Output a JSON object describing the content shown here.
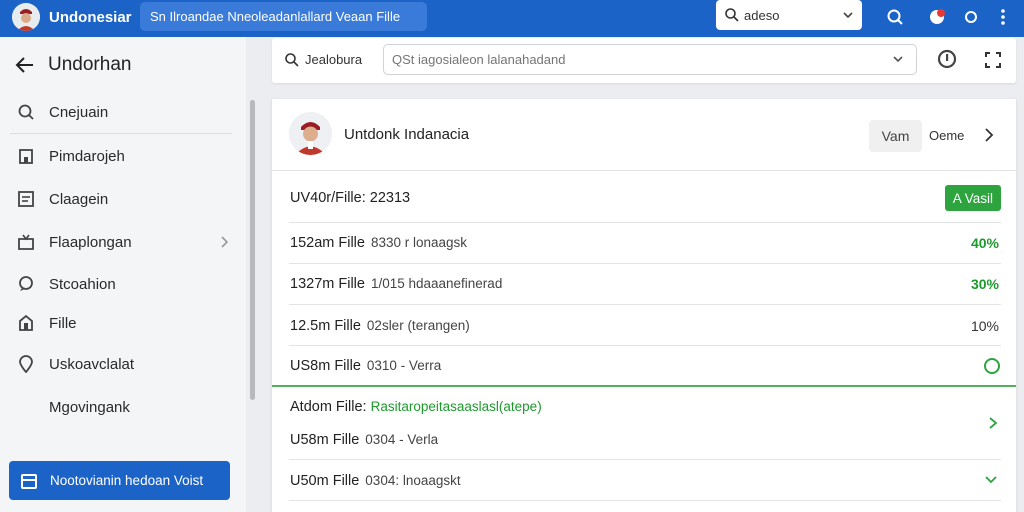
{
  "topbar": {
    "app_title": "Undonesiar",
    "breadcrumb": "Sn Ilroandae Nneoleadanlallard Veaan Fille",
    "search_value": "adeso",
    "icons": [
      "notification-icon",
      "alert-icon",
      "help-icon",
      "more-vert-icon"
    ],
    "colors": {
      "brand": "#1b63c6",
      "accent_green": "#2ea43f"
    }
  },
  "sidebar": {
    "title": "Undorhan",
    "items": [
      {
        "label": "Cnejuain",
        "icon": "search-people-icon"
      },
      {
        "label": "Pimdarojeh",
        "icon": "building-icon"
      },
      {
        "label": "Claagein",
        "icon": "document-icon"
      },
      {
        "label": "Flaaplongan",
        "icon": "inbox-icon",
        "has_chevron": true
      },
      {
        "label": "Stcoahion",
        "icon": "chat-icon"
      },
      {
        "label": "Fille",
        "icon": "store-icon"
      },
      {
        "label": "Uskoavclalat",
        "icon": "location-icon"
      },
      {
        "label": "Mgovingank",
        "icon": ""
      }
    ],
    "action_button": "Nootovianin hedoan Voist"
  },
  "searchbar": {
    "label": "Jealobura",
    "placeholder": "QSt iagosialeon lalanahadand"
  },
  "card": {
    "user_name": "Untdonk Indanacia",
    "button_label": "Vam",
    "link_label": "Oeme",
    "header_row": {
      "name": "UV40r/Fille: 22313",
      "badge": "A Vasil"
    },
    "rows": [
      {
        "name": "152am Fille",
        "desc": "8330 r lonaagsk",
        "pct": "40%",
        "pct_color": "#1e9a2d"
      },
      {
        "name": "1327m Fille",
        "desc": "1/015 hdaaanefinerad",
        "pct": "30%",
        "pct_color": "#1e9a2d"
      },
      {
        "name": "12.5m Fille",
        "desc": "02sler (terangen)",
        "pct": "10%",
        "pct_color": "#333333"
      },
      {
        "name": "US8m Fille",
        "desc": "0310 - Verra",
        "status": "circle"
      }
    ],
    "section2": {
      "title_prefix": "Atdom Fille:",
      "title_green": "Rasitaropeitasaaslasl(atepe)",
      "rows": [
        {
          "name": "U58m Fille",
          "desc": "0304 - Verla"
        },
        {
          "name": "U50m Fille",
          "desc": "0304: lnoaagskt"
        }
      ]
    }
  }
}
